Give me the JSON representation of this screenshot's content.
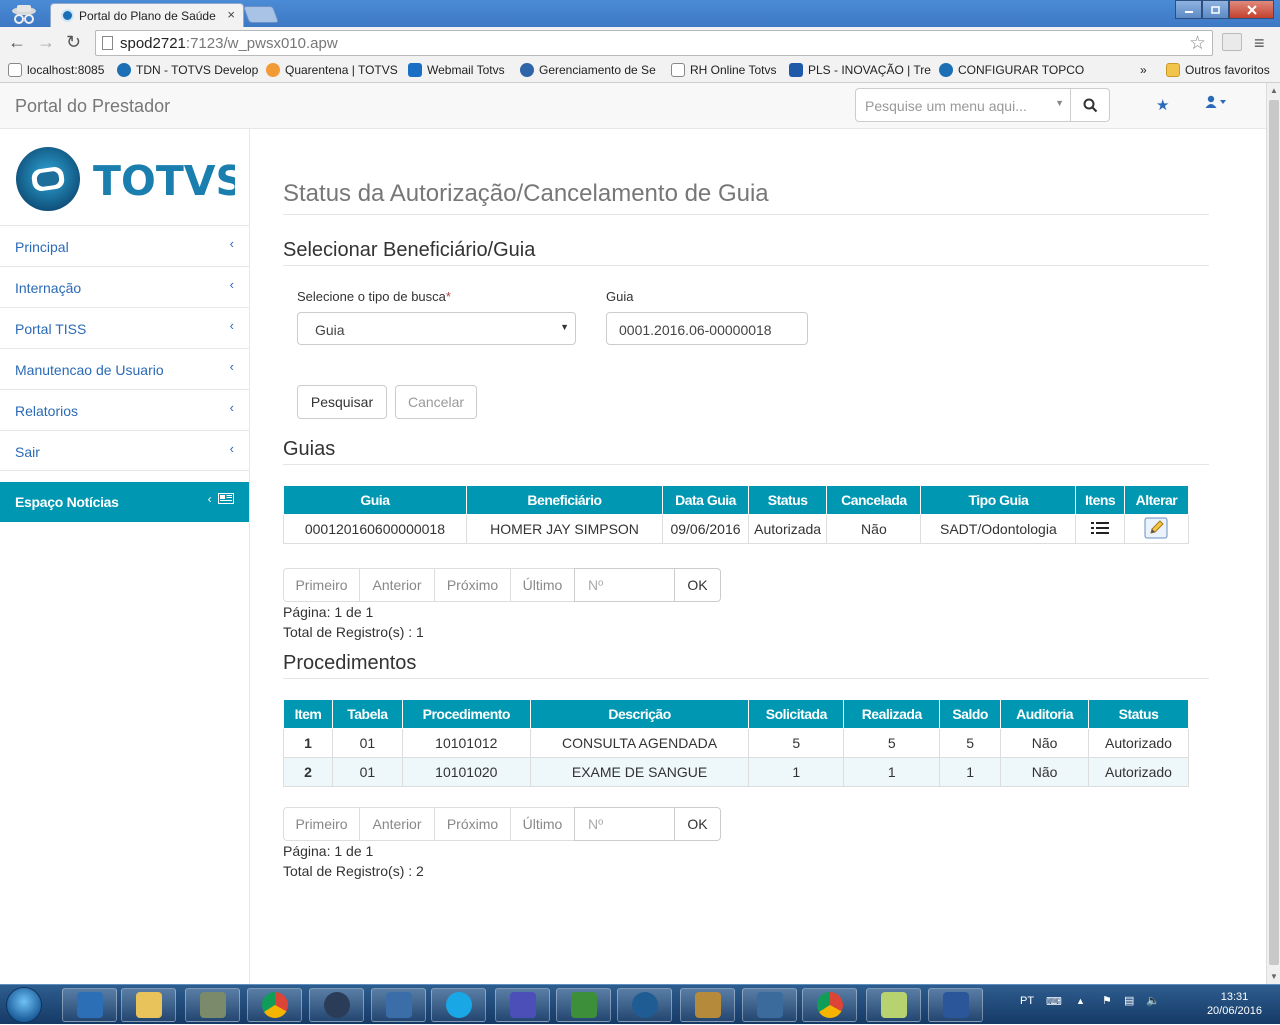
{
  "browser": {
    "tab_title": "Portal do Plano de Saúde",
    "tab_close": "×",
    "url_host": "spod2721",
    "url_rest": ":7123/w_pwsx010.apw",
    "bookmarks": [
      {
        "label": "localhost:8085",
        "color": "#d9d9d9"
      },
      {
        "label": "TDN - TOTVS Develop",
        "color": "#1c6fb4"
      },
      {
        "label": "Quarentena | TOTVS",
        "color": "#f29b36"
      },
      {
        "label": "Webmail Totvs",
        "color": "#1a6fc4"
      },
      {
        "label": "Gerenciamento de Se",
        "color": "#2f64a8"
      },
      {
        "label": "RH Online Totvs",
        "color": "#ffffff"
      },
      {
        "label": "PLS - INOVAÇÃO | Tre",
        "color": "#1e5aa8"
      },
      {
        "label": "CONFIGURAR TOPCO",
        "color": "#1c6fb4"
      }
    ],
    "bookmarks_more": "»",
    "other_bookmarks": "Outros favoritos"
  },
  "header": {
    "brand": "Portal do Prestador",
    "menu_search_placeholder": "Pesquise um menu aqui..."
  },
  "sidebar": {
    "logo_text": "TOTVS",
    "items": [
      {
        "label": "Principal"
      },
      {
        "label": "Internação"
      },
      {
        "label": "Portal TISS"
      },
      {
        "label": "Manutencao de Usuario"
      },
      {
        "label": "Relatorios"
      },
      {
        "label": "Sair"
      }
    ],
    "chevron": "‹",
    "news_label": "Espaço Notícias"
  },
  "main": {
    "page_title": "Status da Autorização/Cancelamento de Guia",
    "section_select": "Selecionar Beneficiário/Guia",
    "search_type_label": "Selecione o tipo de busca",
    "required_mark": "*",
    "search_type_value": "Guia",
    "guia_label": "Guia",
    "guia_value": "0001.2016.06-00000018",
    "search_button": "Pesquisar",
    "cancel_button": "Cancelar",
    "section_guias": "Guias",
    "section_procedimentos": "Procedimentos"
  },
  "guias_table": {
    "headers": [
      "Guia",
      "Beneficiário",
      "Data Guia",
      "Status",
      "Cancelada",
      "Tipo Guia",
      "Itens",
      "Alterar"
    ],
    "rows": [
      [
        "000120160600000018",
        "HOMER JAY SIMPSON",
        "09/06/2016",
        "Autorizada",
        "Não",
        "SADT/Odontologia"
      ]
    ]
  },
  "pager": {
    "first": "Primeiro",
    "prev": "Anterior",
    "next": "Próximo",
    "last": "Último",
    "num_placeholder": "Nº",
    "ok": "OK"
  },
  "guias_info": {
    "page": "Página: 1 de 1",
    "total": "Total de Registro(s) : 1"
  },
  "proc_table": {
    "headers": [
      "Item",
      "Tabela",
      "Procedimento",
      "Descrição",
      "Solicitada",
      "Realizada",
      "Saldo",
      "Auditoria",
      "Status"
    ],
    "rows": [
      [
        "1",
        "01",
        "10101012",
        "CONSULTA AGENDADA",
        "5",
        "5",
        "5",
        "Não",
        "Autorizado"
      ],
      [
        "2",
        "01",
        "10101020",
        "EXAME DE SANGUE",
        "1",
        "1",
        "1",
        "Não",
        "Autorizado"
      ]
    ]
  },
  "proc_info": {
    "page": "Página: 1 de 1",
    "total": "Total de Registro(s) : 2"
  },
  "taskbar": {
    "lang": "PT",
    "time": "13:31",
    "date": "20/06/2016"
  },
  "colors": {
    "accent": "#0097b2",
    "link": "#2a6ab6"
  }
}
